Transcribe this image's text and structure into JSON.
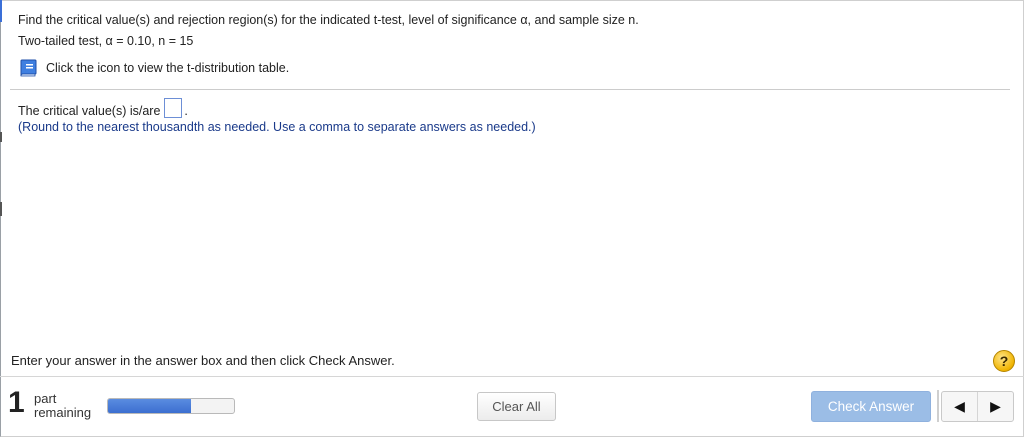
{
  "question": {
    "prompt": "Find the critical value(s) and rejection region(s) for the indicated t-test, level of significance α, and sample size n.",
    "parameters": "Two-tailed test, α = 0.10, n = 15",
    "table_link_icon": "book-icon",
    "table_link_text": "Click the icon to view the t-distribution table."
  },
  "answer": {
    "label": "The critical value(s) is/are",
    "input_value": "",
    "period": ".",
    "hint": "(Round to the nearest thousandth as needed. Use a comma to separate answers as needed.)"
  },
  "instruction": "Enter your answer in the answer box and then click Check Answer.",
  "help_button": {
    "label": "?",
    "icon": "help-icon",
    "color": "#f0b400"
  },
  "footer": {
    "parts_count": "1",
    "parts_line1": "part",
    "parts_line2": "remaining",
    "progress_fraction": 0.66,
    "clear_all_label": "Clear All",
    "check_answer_label": "Check Answer",
    "prev_icon": "arrow-left-icon",
    "next_icon": "arrow-right-icon",
    "accent_color": "#3c6fd0",
    "check_button_color": "#9bbde6"
  }
}
